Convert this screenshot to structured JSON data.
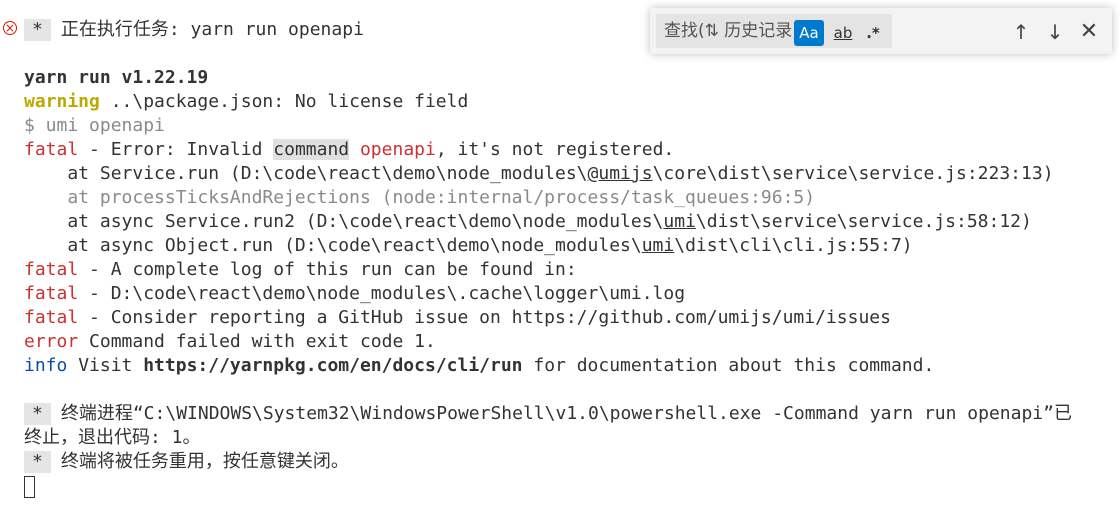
{
  "terminal": {
    "task_line": {
      "badge": "*",
      "text": "正在执行任务: yarn run openapi"
    },
    "yarn_version": "yarn run v1.22.19",
    "warning_line": {
      "level": "warning",
      "text": " ..\\package.json: No license field"
    },
    "cmd_line": "$ umi openapi",
    "fatal_1": {
      "level": "fatal",
      "pre": " - Error: Invalid ",
      "highlight": "command",
      "space": " ",
      "name": "openapi",
      "post": ", it's not registered."
    },
    "stack_1": {
      "pre": "    at Service.run (D:\\code\\react\\demo\\node_modules\\",
      "link": "@umijs",
      "post": "\\core\\dist\\service\\service.js:223:13)"
    },
    "stack_2": "    at processTicksAndRejections (node:internal/process/task_queues:96:5)",
    "stack_3": {
      "pre": "    at async Service.run2 (D:\\code\\react\\demo\\node_modules\\",
      "link": "umi",
      "post": "\\dist\\service\\service.js:58:12)"
    },
    "stack_4": {
      "pre": "    at async Object.run (D:\\code\\react\\demo\\node_modules\\",
      "link": "umi",
      "post": "\\dist\\cli\\cli.js:55:7)"
    },
    "fatal_2": {
      "level": "fatal",
      "text": " - A complete log of this run can be found in:"
    },
    "fatal_3": {
      "level": "fatal",
      "text": " - D:\\code\\react\\demo\\node_modules\\.cache\\logger\\umi.log"
    },
    "fatal_4": {
      "level": "fatal",
      "text": " - Consider reporting a GitHub issue on https://github.com/umijs/umi/issues"
    },
    "error_line": {
      "level": "error",
      "text": " Command failed with exit code 1."
    },
    "info_line": {
      "level": "info",
      "pre": " Visit ",
      "url": "https://yarnpkg.com/en/docs/cli/run",
      "post": " for documentation about this command."
    },
    "process_end": {
      "badge": "*",
      "text": "终端进程“C:\\WINDOWS\\System32\\WindowsPowerShell\\v1.0\\powershell.exe -Command yarn run openapi”已",
      "text_wrap": "终止，退出代码: 1。"
    },
    "reuse_line": {
      "badge": "*",
      "text": "终端将被任务重用，按任意键关闭。"
    }
  },
  "find_widget": {
    "placeholder": "查找(⇅ 历史记录)",
    "match_case": "Aa",
    "whole_word": "ab",
    "regex": ".*",
    "prev": "↑",
    "next": "↓",
    "close": "✕"
  },
  "colors": {
    "error_red": "#cd3131",
    "warning_yellow": "#bbaa00",
    "info_blue": "#0451a5",
    "toggle_active": "#007acc"
  },
  "icons": {
    "task_status": "error-circle-icon",
    "find_prev": "arrow-up-icon",
    "find_next": "arrow-down-icon",
    "find_close": "close-icon"
  }
}
